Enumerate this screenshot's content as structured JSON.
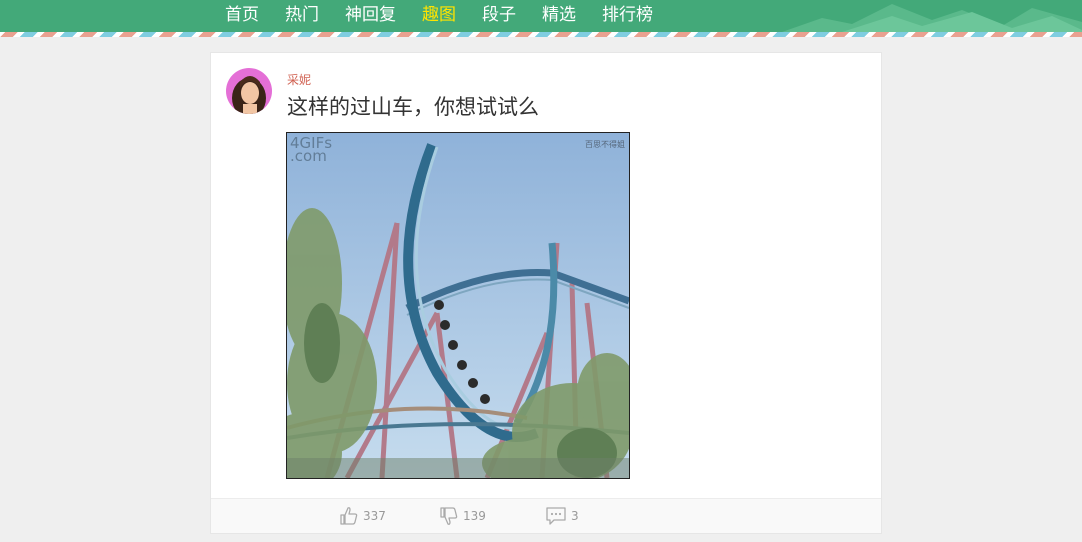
{
  "nav": {
    "items": [
      {
        "label": "首页"
      },
      {
        "label": "热门"
      },
      {
        "label": "神回复"
      },
      {
        "label": "趣图"
      },
      {
        "label": "段子"
      },
      {
        "label": "精选"
      },
      {
        "label": "排行榜"
      }
    ],
    "active_index": 3
  },
  "post": {
    "author": "采妮",
    "title": "这样的过山车，你想试试么",
    "gif_watermark": "4GIFs\n.com",
    "gif_corner_text": "百思不得姐",
    "likes": "337",
    "dislikes": "139",
    "comments": "3"
  },
  "colors": {
    "header_bg": "#43a979",
    "nav_active": "#ffe400",
    "author": "#d06050"
  },
  "icons": {
    "like": "thumbs-up-icon",
    "dislike": "thumbs-down-icon",
    "comment": "comment-bubble-icon"
  }
}
